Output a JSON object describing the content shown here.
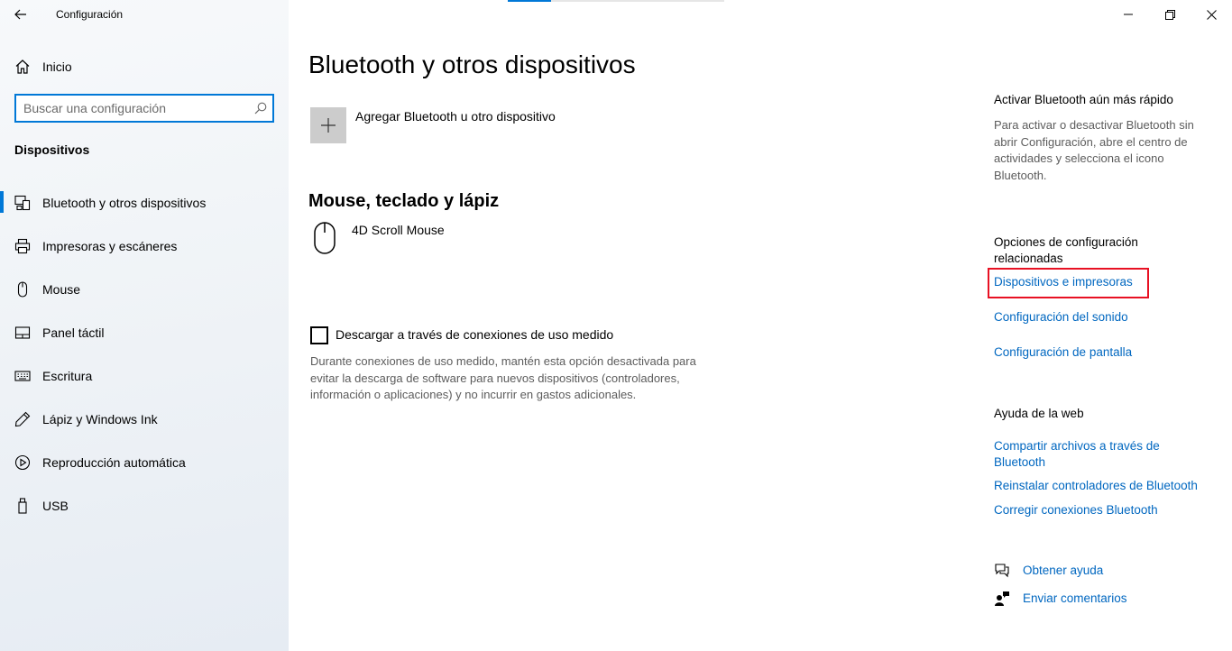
{
  "window": {
    "title": "Configuración"
  },
  "sidebar": {
    "home_label": "Inicio",
    "search_placeholder": "Buscar una configuración",
    "section_heading": "Dispositivos",
    "items": [
      {
        "label": "Bluetooth y otros dispositivos",
        "icon": "bluetooth-devices-icon",
        "active": true
      },
      {
        "label": "Impresoras y escáneres",
        "icon": "printer-icon",
        "active": false
      },
      {
        "label": "Mouse",
        "icon": "mouse-icon",
        "active": false
      },
      {
        "label": "Panel táctil",
        "icon": "touchpad-icon",
        "active": false
      },
      {
        "label": "Escritura",
        "icon": "keyboard-icon",
        "active": false
      },
      {
        "label": "Lápiz y Windows Ink",
        "icon": "pen-icon",
        "active": false
      },
      {
        "label": "Reproducción automática",
        "icon": "autoplay-icon",
        "active": false
      },
      {
        "label": "USB",
        "icon": "usb-icon",
        "active": false
      }
    ]
  },
  "main": {
    "title": "Bluetooth y otros dispositivos",
    "add_device_label": "Agregar Bluetooth u otro dispositivo",
    "group_title": "Mouse, teclado y lápiz",
    "devices": [
      {
        "name": "4D Scroll Mouse",
        "icon": "mouse-icon"
      }
    ],
    "metered": {
      "label": "Descargar a través de conexiones de uso medido",
      "checked": false,
      "description": "Durante conexiones de uso medido, mantén esta opción desactivada para evitar la descarga de software para nuevos dispositivos (controladores, información o aplicaciones) y no incurrir en gastos adicionales."
    }
  },
  "right_panel": {
    "quick_title": "Activar Bluetooth aún más rápido",
    "quick_desc": "Para activar o desactivar Bluetooth sin abrir Configuración, abre el centro de actividades y selecciona el icono Bluetooth.",
    "related_title": "Opciones de configuración relacionadas",
    "related_links": [
      "Dispositivos e impresoras",
      "Configuración del sonido",
      "Configuración de pantalla"
    ],
    "web_help_title": "Ayuda de la web",
    "web_links": [
      "Compartir archivos a través de Bluetooth",
      "Reinstalar controladores de Bluetooth",
      "Corregir conexiones Bluetooth"
    ],
    "get_help": "Obtener ayuda",
    "feedback": "Enviar comentarios"
  },
  "colors": {
    "accent": "#0078d7",
    "link": "#0067c0",
    "highlight_box": "#e81123"
  }
}
